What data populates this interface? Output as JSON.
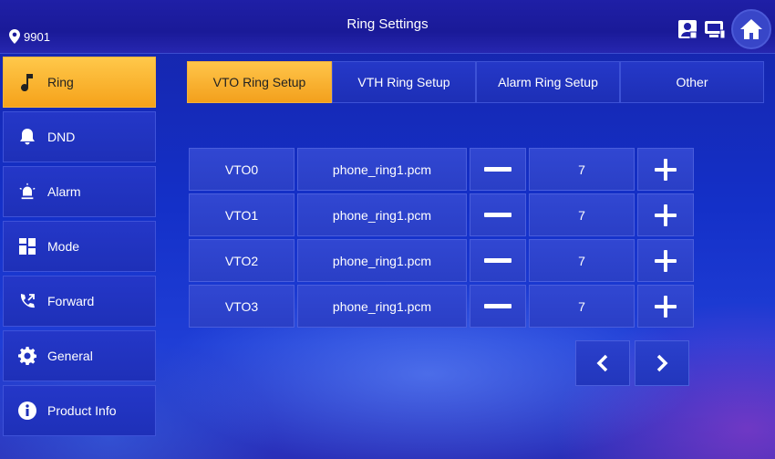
{
  "header": {
    "location": "9901",
    "title": "Ring Settings"
  },
  "sidebar": {
    "items": [
      {
        "label": "Ring",
        "icon": "music-note-icon",
        "active": true
      },
      {
        "label": "DND",
        "icon": "bell-icon",
        "active": false
      },
      {
        "label": "Alarm",
        "icon": "alarm-siren-icon",
        "active": false
      },
      {
        "label": "Mode",
        "icon": "grid-icon",
        "active": false
      },
      {
        "label": "Forward",
        "icon": "call-forward-icon",
        "active": false
      },
      {
        "label": "General",
        "icon": "gear-icon",
        "active": false
      },
      {
        "label": "Product Info",
        "icon": "info-icon",
        "active": false
      }
    ]
  },
  "tabs": [
    {
      "label": "VTO Ring Setup",
      "active": true
    },
    {
      "label": "VTH Ring Setup",
      "active": false
    },
    {
      "label": "Alarm Ring Setup",
      "active": false
    },
    {
      "label": "Other",
      "active": false
    }
  ],
  "rings": [
    {
      "device": "VTO0",
      "file": "phone_ring1.pcm",
      "volume": "7"
    },
    {
      "device": "VTO1",
      "file": "phone_ring1.pcm",
      "volume": "7"
    },
    {
      "device": "VTO2",
      "file": "phone_ring1.pcm",
      "volume": "7"
    },
    {
      "device": "VTO3",
      "file": "phone_ring1.pcm",
      "volume": "7"
    }
  ],
  "colors": {
    "accent": "#f5a21a",
    "background": "#1430c8"
  }
}
